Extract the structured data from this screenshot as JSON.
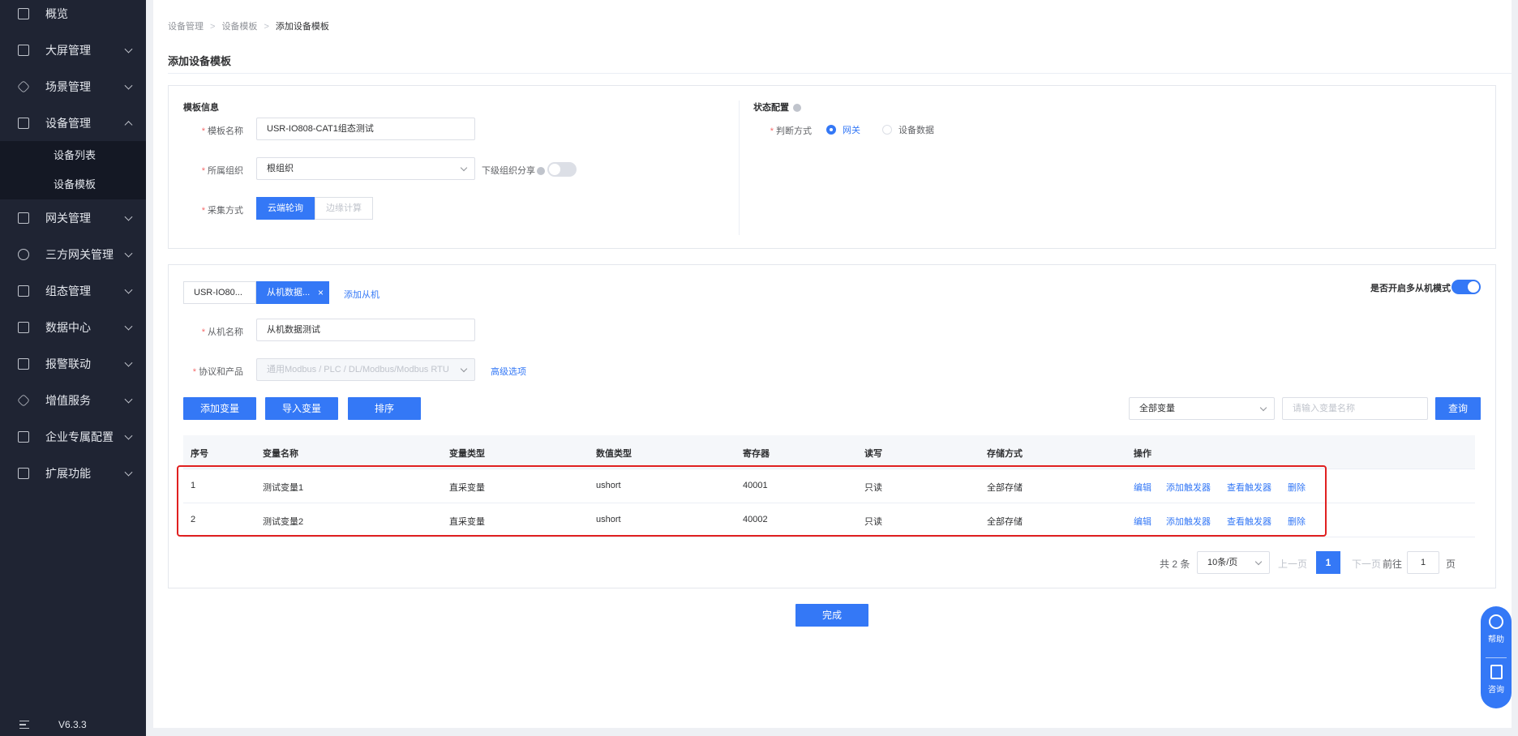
{
  "sidebar": {
    "items": [
      {
        "label": "概览",
        "icon": "overview-icon"
      },
      {
        "label": "大屏管理",
        "icon": "screen-icon"
      },
      {
        "label": "场景管理",
        "icon": "scene-icon"
      },
      {
        "label": "设备管理",
        "icon": "device-icon"
      },
      {
        "label": "网关管理",
        "icon": "gateway-icon"
      },
      {
        "label": "三方网关管理",
        "icon": "third-party-gateway-icon"
      },
      {
        "label": "组态管理",
        "icon": "configuration-icon"
      },
      {
        "label": "数据中心",
        "icon": "data-center-icon"
      },
      {
        "label": "报警联动",
        "icon": "alarm-icon"
      },
      {
        "label": "增值服务",
        "icon": "diamond-icon"
      },
      {
        "label": "企业专属配置",
        "icon": "enterprise-icon"
      },
      {
        "label": "扩展功能",
        "icon": "extension-icon"
      }
    ],
    "submenu": [
      "设备列表",
      "设备模板"
    ],
    "version": "V6.3.3"
  },
  "breadcrumb": [
    "设备管理",
    "设备模板",
    "添加设备模板"
  ],
  "page_title": "添加设备模板",
  "template_info": {
    "title": "模板信息",
    "name_label": "模板名称",
    "name_value": "USR-IO808-CAT1组态测试",
    "org_label": "所属组织",
    "org_value": "根组织",
    "share_label": "下级组织分享",
    "collect_label": "采集方式",
    "collect_options": [
      "云端轮询",
      "边缘计算"
    ]
  },
  "status_config": {
    "title": "状态配置",
    "judge_label": "判断方式",
    "options": [
      "网关",
      "设备数据"
    ]
  },
  "slave": {
    "tabs": [
      "USR-IO80...",
      "从机数据..."
    ],
    "add_slave": "添加从机",
    "multi_slave_label": "是否开启多从机模式",
    "name_label": "从机名称",
    "name_value": "从机数据测试",
    "protocol_label": "协议和产品",
    "protocol_value": "通用Modbus / PLC / DL/Modbus/Modbus RTU",
    "advanced": "高级选项"
  },
  "toolbar": {
    "add_var": "添加变量",
    "import_var": "导入变量",
    "sort": "排序",
    "filter_value": "全部变量",
    "search_placeholder": "请输入变量名称",
    "query": "查询"
  },
  "table": {
    "headers": [
      "序号",
      "变量名称",
      "变量类型",
      "数值类型",
      "寄存器",
      "读写",
      "存储方式",
      "操作"
    ],
    "rows": [
      [
        "1",
        "测试变量1",
        "直采变量",
        "ushort",
        "40001",
        "只读",
        "全部存储"
      ],
      [
        "2",
        "测试变量2",
        "直采变量",
        "ushort",
        "40002",
        "只读",
        "全部存储"
      ]
    ],
    "actions": [
      "编辑",
      "添加触发器",
      "查看触发器",
      "删除"
    ]
  },
  "pagination": {
    "total": "共 2 条",
    "page_size": "10条/页",
    "prev": "上一页",
    "current": "1",
    "next": "下一页",
    "goto": "前往",
    "goto_value": "1",
    "page_unit": "页"
  },
  "finish": "完成",
  "float_help": {
    "help": "帮助",
    "consult": "咨询"
  },
  "colors": {
    "primary": "#3478f6",
    "sidebar": "#1f2433",
    "highlight": "#e02020"
  }
}
